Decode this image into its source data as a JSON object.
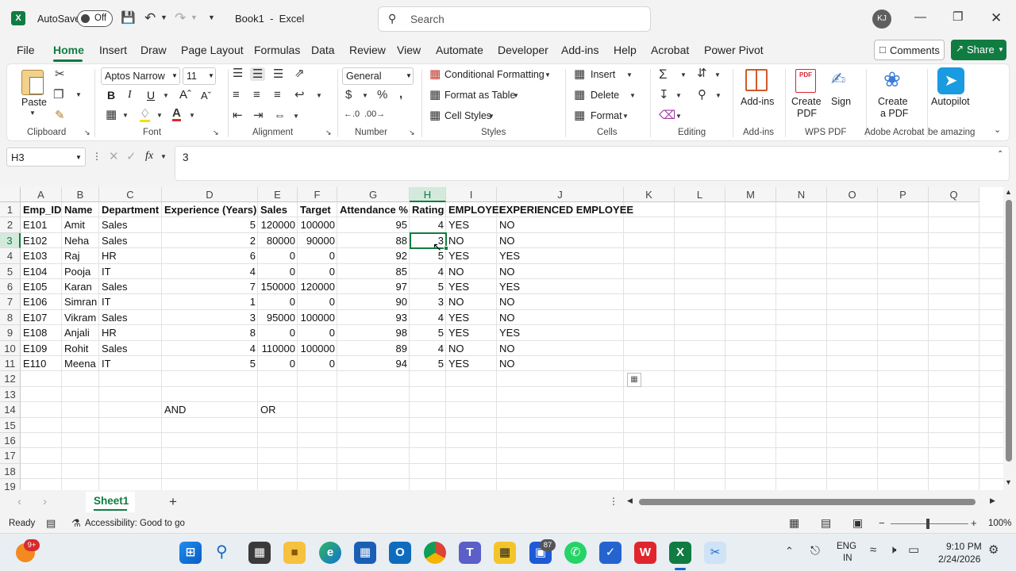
{
  "title_bar": {
    "autosave_label": "AutoSave",
    "autosave_state": "Off",
    "doc_title": "Book1  -  Excel",
    "search_placeholder": "Search",
    "user_initials": "KJ"
  },
  "menu": {
    "items": [
      "File",
      "Home",
      "Insert",
      "Draw",
      "Page Layout",
      "Formulas",
      "Data",
      "Review",
      "View",
      "Automate",
      "Developer",
      "Add-ins",
      "Help",
      "Acrobat",
      "Power Pivot"
    ],
    "active": "Home",
    "comments_label": "Comments",
    "share_label": "Share"
  },
  "ribbon": {
    "clipboard": {
      "paste": "Paste",
      "label": "Clipboard"
    },
    "font": {
      "name": "Aptos Narrow",
      "size": "11",
      "label": "Font",
      "bold": "B",
      "italic": "I",
      "underline": "U"
    },
    "alignment": {
      "label": "Alignment"
    },
    "number": {
      "format": "General",
      "label": "Number"
    },
    "styles": {
      "conditional": "Conditional Formatting",
      "format_table": "Format as Table",
      "cell_styles": "Cell Styles",
      "label": "Styles"
    },
    "cells": {
      "insert": "Insert",
      "delete": "Delete",
      "format": "Format",
      "label": "Cells"
    },
    "editing": {
      "label": "Editing"
    },
    "addins": {
      "button": "Add-ins",
      "label": "Add-ins"
    },
    "wps": {
      "create_pdf_1": "Create",
      "create_pdf_2": "PDF",
      "sign": "Sign",
      "label": "WPS PDF"
    },
    "acrobat": {
      "create_1": "Create",
      "create_2": "a PDF",
      "label": "Adobe Acrobat"
    },
    "autopilot": {
      "button": "Autopilot",
      "label": "be amazing"
    }
  },
  "formula_bar": {
    "name_box": "H3",
    "fx": "fx",
    "value": "3"
  },
  "grid": {
    "columns": [
      "A",
      "B",
      "C",
      "D",
      "E",
      "F",
      "G",
      "H",
      "I",
      "J",
      "K",
      "L",
      "M",
      "N",
      "O",
      "P",
      "Q"
    ],
    "rows": [
      "1",
      "2",
      "3",
      "4",
      "5",
      "6",
      "7",
      "8",
      "9",
      "10",
      "11",
      "12",
      "13",
      "14",
      "15",
      "16",
      "17",
      "18",
      "19"
    ],
    "headers": [
      "Emp_ID",
      "Name",
      "Department",
      "Experience (Years)",
      "Sales",
      "Target",
      "Attendance %",
      "Rating",
      "EMPLOYEE",
      "EXPERIENCED EMPLOYEE"
    ],
    "data": [
      [
        "E101",
        "Amit",
        "Sales",
        "5",
        "120000",
        "100000",
        "95",
        "4",
        "YES",
        "NO"
      ],
      [
        "E102",
        "Neha",
        "Sales",
        "2",
        "80000",
        "90000",
        "88",
        "3",
        "NO",
        "NO"
      ],
      [
        "E103",
        "Raj",
        "HR",
        "6",
        "0",
        "0",
        "92",
        "5",
        "YES",
        "YES"
      ],
      [
        "E104",
        "Pooja",
        "IT",
        "4",
        "0",
        "0",
        "85",
        "4",
        "NO",
        "NO"
      ],
      [
        "E105",
        "Karan",
        "Sales",
        "7",
        "150000",
        "120000",
        "97",
        "5",
        "YES",
        "YES"
      ],
      [
        "E106",
        "Simran",
        "IT",
        "1",
        "0",
        "0",
        "90",
        "3",
        "NO",
        "NO"
      ],
      [
        "E107",
        "Vikram",
        "Sales",
        "3",
        "95000",
        "100000",
        "93",
        "4",
        "YES",
        "NO"
      ],
      [
        "E108",
        "Anjali",
        "HR",
        "8",
        "0",
        "0",
        "98",
        "5",
        "YES",
        "YES"
      ],
      [
        "E109",
        "Rohit",
        "Sales",
        "4",
        "110000",
        "100000",
        "89",
        "4",
        "NO",
        "NO"
      ],
      [
        "E110",
        "Meena",
        "IT",
        "5",
        "0",
        "0",
        "94",
        "5",
        "YES",
        "NO"
      ]
    ],
    "and_label": "AND",
    "or_label": "OR",
    "selected_cell": "H3"
  },
  "sheets": {
    "tabs": [
      "Sheet1"
    ],
    "active": "Sheet1"
  },
  "status": {
    "ready": "Ready",
    "accessibility": "Accessibility: Good to go",
    "zoom": "100%"
  },
  "taskbar": {
    "badge_start": "9+",
    "badge_teams": "87",
    "lang_1": "ENG",
    "lang_2": "IN",
    "time": "9:10 PM",
    "date": "2/24/2026"
  }
}
